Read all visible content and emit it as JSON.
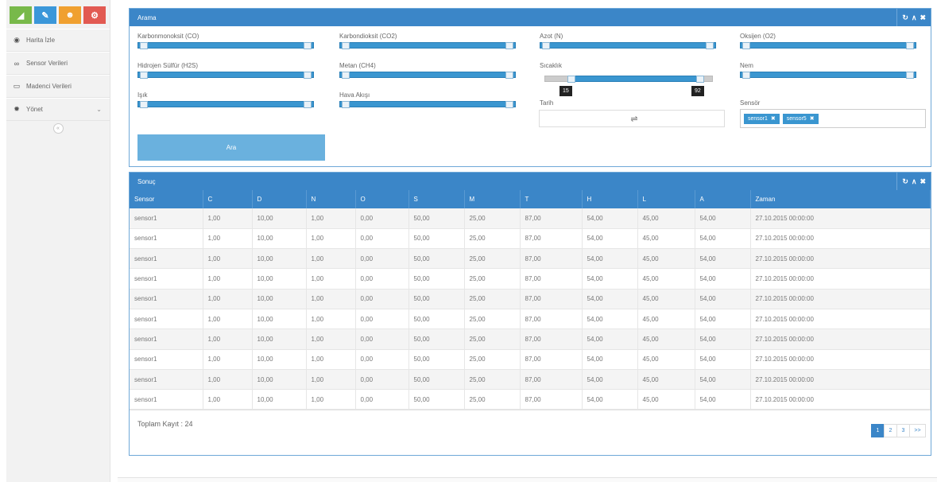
{
  "sidebar": {
    "shortcut_colors": [
      "#78b94a",
      "#3b97d9",
      "#f0a030",
      "#e25a52"
    ],
    "shortcut_icons": [
      "chart-icon",
      "pencil-icon",
      "users-icon",
      "cogs-icon"
    ],
    "items": [
      {
        "label": "Harita İzle",
        "icon": "eye-icon"
      },
      {
        "label": "Sensor Verileri",
        "icon": "binoculars-icon"
      },
      {
        "label": "Madenci Verileri",
        "icon": "desktop-icon"
      },
      {
        "label": "Yönet",
        "icon": "gear-icon"
      }
    ],
    "collapse_symbol": "«"
  },
  "search_panel": {
    "title": "Arama",
    "fields": {
      "co": "Karbonmonoksit (CO)",
      "co2": "Karbondioksit (CO2)",
      "n": "Azot (N)",
      "o2": "Oksijen (O2)",
      "h2s": "Hidrojen Sülfür (H2S)",
      "ch4": "Metan (CH4)",
      "temp": "Sıcaklık",
      "humidity": "Nem",
      "light": "Işık",
      "airflow": "Hava Akışı",
      "date": "Tarih",
      "sensor": "Sensör"
    },
    "temp_range": {
      "min": "15",
      "max": "92"
    },
    "date_separator": "⇌",
    "sensor_tags": [
      "sensor1",
      "sensor5"
    ],
    "search_button": "Ara"
  },
  "result_panel": {
    "title": "Sonuç",
    "columns": [
      "Sensor",
      "C",
      "D",
      "N",
      "O",
      "S",
      "M",
      "T",
      "H",
      "L",
      "A",
      "Zaman"
    ],
    "rows": [
      [
        "sensor1",
        "1,00",
        "10,00",
        "1,00",
        "0,00",
        "50,00",
        "25,00",
        "87,00",
        "54,00",
        "45,00",
        "54,00",
        "27.10.2015 00:00:00"
      ],
      [
        "sensor1",
        "1,00",
        "10,00",
        "1,00",
        "0,00",
        "50,00",
        "25,00",
        "87,00",
        "54,00",
        "45,00",
        "54,00",
        "27.10.2015 00:00:00"
      ],
      [
        "sensor1",
        "1,00",
        "10,00",
        "1,00",
        "0,00",
        "50,00",
        "25,00",
        "87,00",
        "54,00",
        "45,00",
        "54,00",
        "27.10.2015 00:00:00"
      ],
      [
        "sensor1",
        "1,00",
        "10,00",
        "1,00",
        "0,00",
        "50,00",
        "25,00",
        "87,00",
        "54,00",
        "45,00",
        "54,00",
        "27.10.2015 00:00:00"
      ],
      [
        "sensor1",
        "1,00",
        "10,00",
        "1,00",
        "0,00",
        "50,00",
        "25,00",
        "87,00",
        "54,00",
        "45,00",
        "54,00",
        "27.10.2015 00:00:00"
      ],
      [
        "sensor1",
        "1,00",
        "10,00",
        "1,00",
        "0,00",
        "50,00",
        "25,00",
        "87,00",
        "54,00",
        "45,00",
        "54,00",
        "27.10.2015 00:00:00"
      ],
      [
        "sensor1",
        "1,00",
        "10,00",
        "1,00",
        "0,00",
        "50,00",
        "25,00",
        "87,00",
        "54,00",
        "45,00",
        "54,00",
        "27.10.2015 00:00:00"
      ],
      [
        "sensor1",
        "1,00",
        "10,00",
        "1,00",
        "0,00",
        "50,00",
        "25,00",
        "87,00",
        "54,00",
        "45,00",
        "54,00",
        "27.10.2015 00:00:00"
      ],
      [
        "sensor1",
        "1,00",
        "10,00",
        "1,00",
        "0,00",
        "50,00",
        "25,00",
        "87,00",
        "54,00",
        "45,00",
        "54,00",
        "27.10.2015 00:00:00"
      ],
      [
        "sensor1",
        "1,00",
        "10,00",
        "1,00",
        "0,00",
        "50,00",
        "25,00",
        "87,00",
        "54,00",
        "45,00",
        "54,00",
        "27.10.2015 00:00:00"
      ]
    ],
    "total": "Toplam Kayıt : 24",
    "pages": [
      "1",
      "2",
      "3",
      ">>"
    ],
    "active_page": "1"
  },
  "panel_tools": {
    "refresh": "↻",
    "collapse": "∧",
    "close": "✖"
  }
}
